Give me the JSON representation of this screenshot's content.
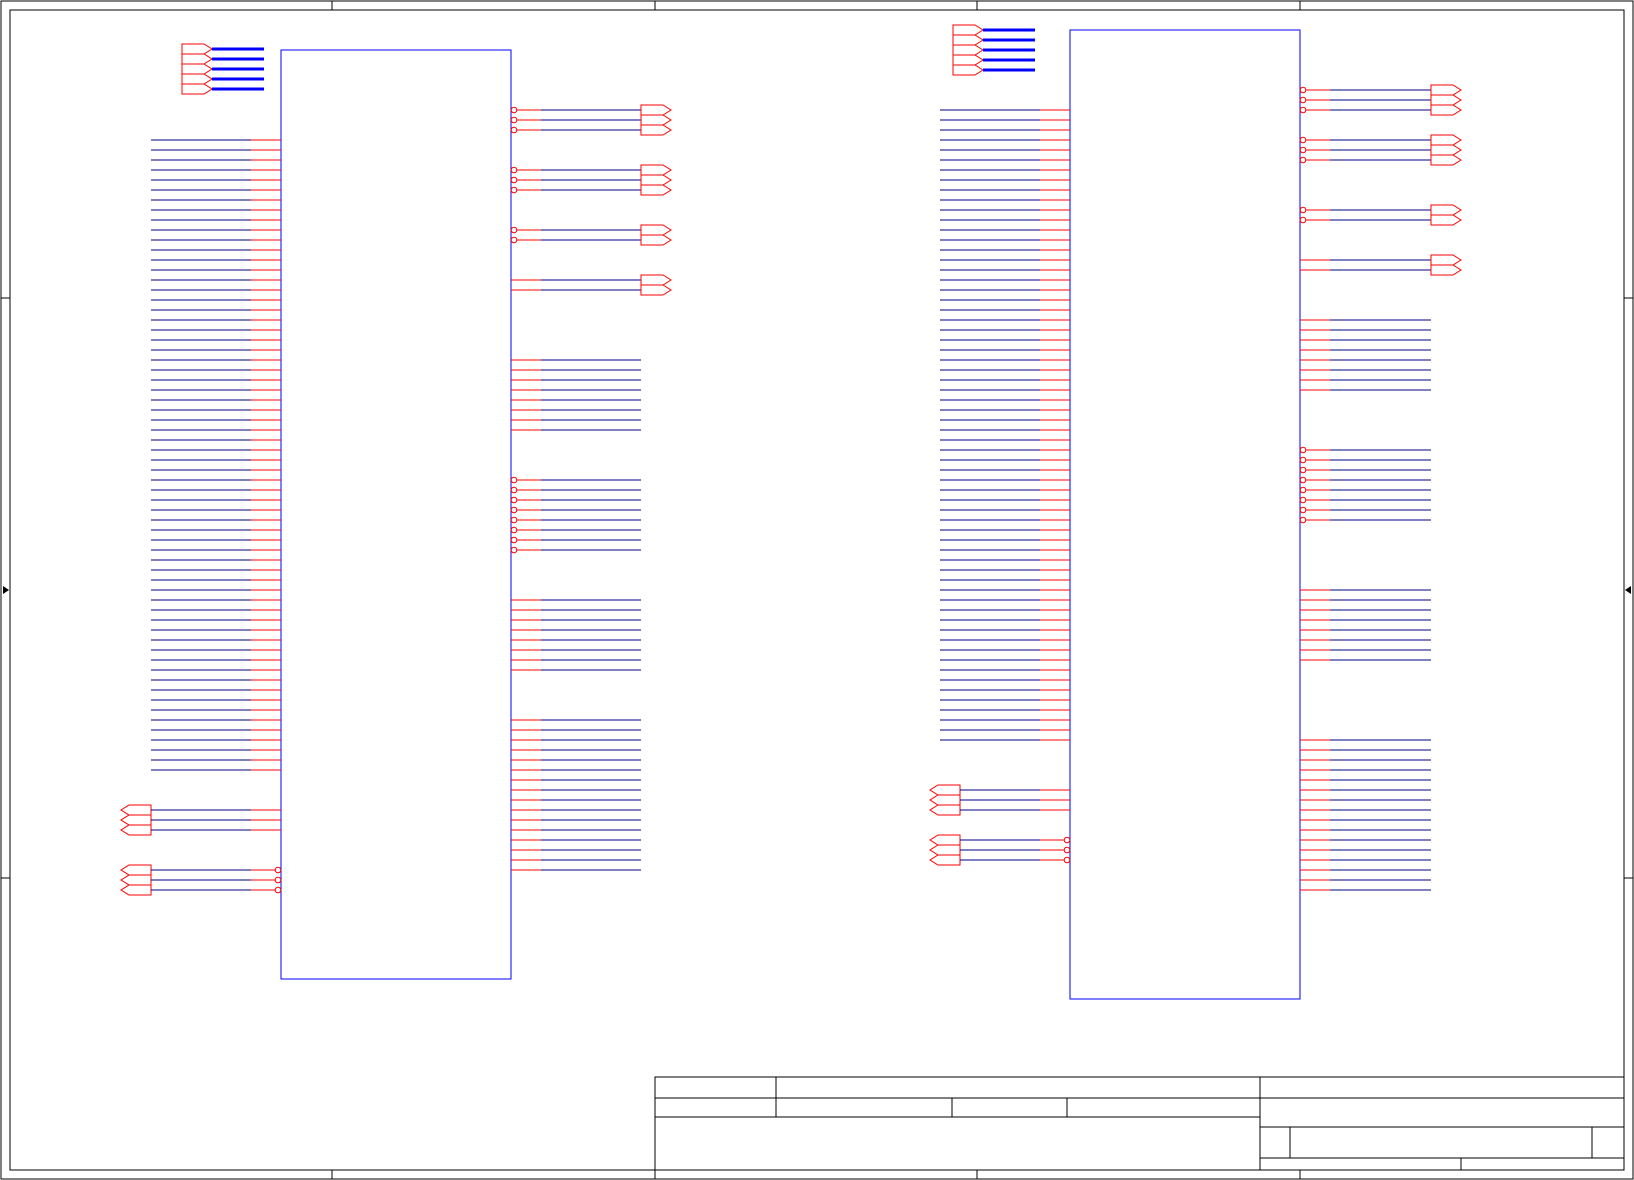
{
  "sheet": {
    "colors": {
      "frame": "#000000",
      "component_body": "#0000ff",
      "pin": "#ff0000",
      "wire": "#000080",
      "bus": "#0000ff"
    },
    "zone_markers": [
      "arrow-left-icon",
      "arrow-right-icon"
    ]
  },
  "components": [
    {
      "id": "left-ic",
      "left_pins": {
        "count": 64,
        "style": "plain"
      },
      "right_pin_groups": [
        {
          "count": 3,
          "with_port": true,
          "inverted": true
        },
        {
          "count": 3,
          "with_port": true,
          "inverted": true
        },
        {
          "count": 2,
          "with_port": true,
          "inverted": true
        },
        {
          "count": 2,
          "with_port": true,
          "inverted": false
        },
        {
          "count": 8,
          "with_port": false,
          "inverted": false
        },
        {
          "count": 8,
          "with_port": false,
          "inverted": true
        },
        {
          "count": 8,
          "with_port": false,
          "inverted": false
        },
        {
          "count": 16,
          "with_port": false,
          "inverted": false
        }
      ],
      "left_port_groups": [
        {
          "count": 3,
          "inverted": false
        },
        {
          "count": 3,
          "inverted": true
        }
      ],
      "bus_ports": 5
    },
    {
      "id": "right-ic",
      "left_pins": {
        "count": 64,
        "style": "plain"
      },
      "right_pin_groups": [
        {
          "count": 3,
          "with_port": true,
          "inverted": true
        },
        {
          "count": 3,
          "with_port": true,
          "inverted": true
        },
        {
          "count": 2,
          "with_port": true,
          "inverted": true
        },
        {
          "count": 2,
          "with_port": true,
          "inverted": false
        },
        {
          "count": 8,
          "with_port": false,
          "inverted": false
        },
        {
          "count": 8,
          "with_port": false,
          "inverted": true
        },
        {
          "count": 8,
          "with_port": false,
          "inverted": false
        },
        {
          "count": 16,
          "with_port": false,
          "inverted": false
        }
      ],
      "left_port_groups": [
        {
          "count": 3,
          "inverted": false
        },
        {
          "count": 3,
          "inverted": true
        }
      ],
      "bus_ports": 5
    }
  ],
  "title_block": {
    "title": "",
    "number": "",
    "revision": "",
    "size": "",
    "date": "",
    "file": "",
    "sheet": "",
    "drawn_by": ""
  }
}
